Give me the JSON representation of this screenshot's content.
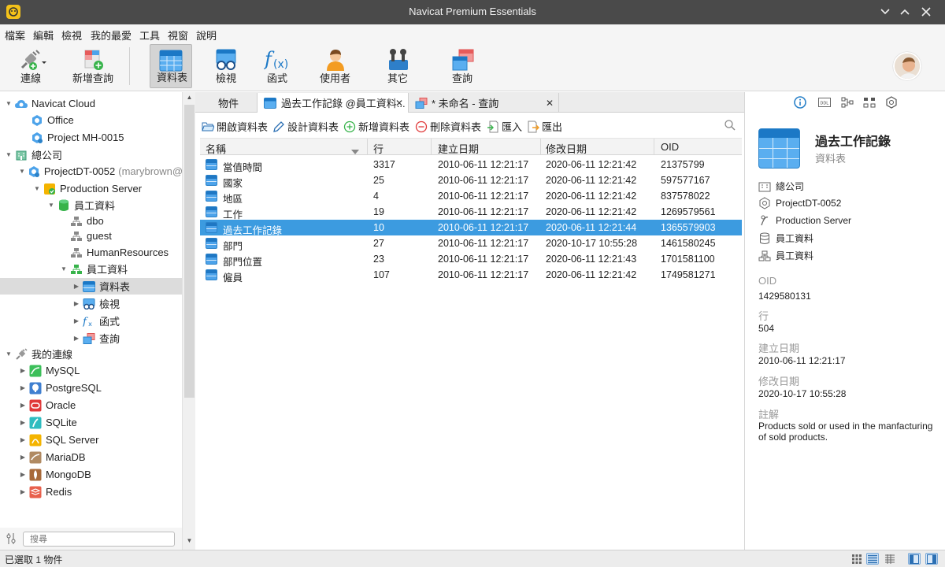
{
  "window": {
    "title": "Navicat Premium Essentials"
  },
  "menu": [
    "檔案",
    "編輯",
    "檢視",
    "我的最愛",
    "工具",
    "視窗",
    "說明"
  ],
  "toolbar": {
    "connection": "連線",
    "new_query": "新增查詢",
    "table": "資料表",
    "view": "檢視",
    "function": "函式",
    "user": "使用者",
    "others": "其它",
    "query": "查詢"
  },
  "tree": {
    "navicat_cloud": "Navicat Cloud",
    "office": "Office",
    "project_mh": "Project MH-0015",
    "company": "總公司",
    "project_dt": "ProjectDT-0052",
    "project_dt_user": "(marybrown@",
    "production_server": "Production Server",
    "employee_db": "員工資料",
    "dbo": "dbo",
    "guest": "guest",
    "human_resources": "HumanResources",
    "employee_schema": "員工資料",
    "tables": "資料表",
    "views": "檢視",
    "functions": "函式",
    "queries": "查詢",
    "my_connections": "我的連線",
    "mysql": "MySQL",
    "postgresql": "PostgreSQL",
    "oracle": "Oracle",
    "sqlite": "SQLite",
    "sqlserver": "SQL Server",
    "mariadb": "MariaDB",
    "mongodb": "MongoDB",
    "redis": "Redis"
  },
  "search": {
    "placeholder": "搜尋"
  },
  "tabs": {
    "objects": "物件",
    "table_tab": "過去工作記錄 @員工資料...",
    "query_tab": "* 未命名 - 查詢"
  },
  "actions": {
    "open_table": "開啟資料表",
    "design_table": "設計資料表",
    "new_table": "新增資料表",
    "delete_table": "刪除資料表",
    "import": "匯入",
    "export": "匯出"
  },
  "grid": {
    "headers": {
      "name": "名稱",
      "rows": "行",
      "created": "建立日期",
      "modified": "修改日期",
      "oid": "OID"
    },
    "rows": [
      {
        "name": "當值時間",
        "rows": "3317",
        "created": "2010-06-11 12:21:17",
        "modified": "2020-06-11 12:21:42",
        "oid": "21375799"
      },
      {
        "name": "國家",
        "rows": "25",
        "created": "2010-06-11 12:21:17",
        "modified": "2020-06-11 12:21:42",
        "oid": "597577167"
      },
      {
        "name": "地區",
        "rows": "4",
        "created": "2010-06-11 12:21:17",
        "modified": "2020-06-11 12:21:42",
        "oid": "837578022"
      },
      {
        "name": "工作",
        "rows": "19",
        "created": "2010-06-11 12:21:17",
        "modified": "2020-06-11 12:21:42",
        "oid": "1269579561"
      },
      {
        "name": "過去工作記錄",
        "rows": "10",
        "created": "2010-06-11 12:21:17",
        "modified": "2020-06-11 12:21:44",
        "oid": "1365579903"
      },
      {
        "name": "部門",
        "rows": "27",
        "created": "2010-06-11 12:21:17",
        "modified": "2020-10-17 10:55:28",
        "oid": "1461580245"
      },
      {
        "name": "部門位置",
        "rows": "23",
        "created": "2010-06-11 12:21:17",
        "modified": "2020-06-11 12:21:43",
        "oid": "1701581100"
      },
      {
        "name": "僱員",
        "rows": "107",
        "created": "2010-06-11 12:21:17",
        "modified": "2020-06-11 12:21:42",
        "oid": "1749581271"
      }
    ]
  },
  "info": {
    "title": "過去工作記錄",
    "type": "資料表",
    "path": [
      "總公司",
      "ProjectDT-0052",
      "Production Server",
      "員工資料",
      "員工資料"
    ],
    "oid_label": "OID",
    "oid_value": "1429580131",
    "rows_label": "行",
    "rows_value": "504",
    "created_label": "建立日期",
    "created_value": "2010-06-11 12:21:17",
    "modified_label": "修改日期",
    "modified_value": "2020-10-17 10:55:28",
    "comment_label": "註解",
    "comment_value": "Products sold or used in the manfacturing of sold products."
  },
  "status": {
    "text": "已選取 1 物件"
  },
  "colors": {
    "accent": "#3c9be0",
    "table_blue": "#4da3ea",
    "titlebar": "#4a4a4a"
  }
}
